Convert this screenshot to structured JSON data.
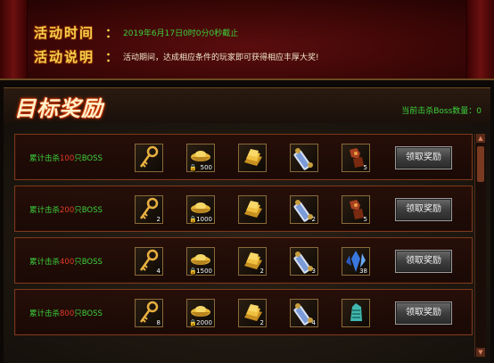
{
  "header": {
    "time_label": "活动时间",
    "time_value": "2019年6月17日0时0分0秒截止",
    "desc_label": "活动说明",
    "desc_value": "活动期间，达成相应条件的玩家即可获得相应丰厚大奖!"
  },
  "main": {
    "title": "目标奖励",
    "boss_count_label": "当前击杀Boss数量：0"
  },
  "rewards": [
    {
      "prefix": "累计击杀",
      "num": "100",
      "suffix": "只BOSS",
      "items": [
        {
          "icon": "golden-key-icon",
          "count": ""
        },
        {
          "icon": "gold-ingot-icon",
          "count": "500",
          "locked": true
        },
        {
          "icon": "gold-bars-icon",
          "count": ""
        },
        {
          "icon": "scroll-icon",
          "count": ""
        },
        {
          "icon": "armor-piece-icon",
          "count": "5"
        }
      ],
      "button": "领取奖励"
    },
    {
      "prefix": "累计击杀",
      "num": "200",
      "suffix": "只BOSS",
      "items": [
        {
          "icon": "golden-key-icon",
          "count": "2"
        },
        {
          "icon": "gold-ingot-icon",
          "count": "1000",
          "locked": true
        },
        {
          "icon": "gold-bars-icon",
          "count": ""
        },
        {
          "icon": "scroll-icon",
          "count": "2"
        },
        {
          "icon": "armor-piece-icon",
          "count": "5"
        }
      ],
      "button": "领取奖励"
    },
    {
      "prefix": "累计击杀",
      "num": "400",
      "suffix": "只BOSS",
      "items": [
        {
          "icon": "golden-key-icon",
          "count": "4"
        },
        {
          "icon": "gold-ingot-icon",
          "count": "1500",
          "locked": true
        },
        {
          "icon": "gold-bars-icon",
          "count": "2"
        },
        {
          "icon": "scroll-icon",
          "count": "3"
        },
        {
          "icon": "blue-crystal-icon",
          "count": "38"
        }
      ],
      "button": "领取奖励"
    },
    {
      "prefix": "累计击杀",
      "num": "800",
      "suffix": "只BOSS",
      "items": [
        {
          "icon": "golden-key-icon",
          "count": "8"
        },
        {
          "icon": "gold-ingot-icon",
          "count": "2000",
          "locked": true
        },
        {
          "icon": "gold-bars-icon",
          "count": "2"
        },
        {
          "icon": "scroll-icon",
          "count": "4"
        },
        {
          "icon": "teal-gauntlet-icon",
          "count": ""
        }
      ],
      "button": "领取奖励"
    }
  ],
  "colors": {
    "accent_green": "#3cd23c",
    "count_red": "#e23b2a",
    "title_gold": "#f6d24a"
  }
}
